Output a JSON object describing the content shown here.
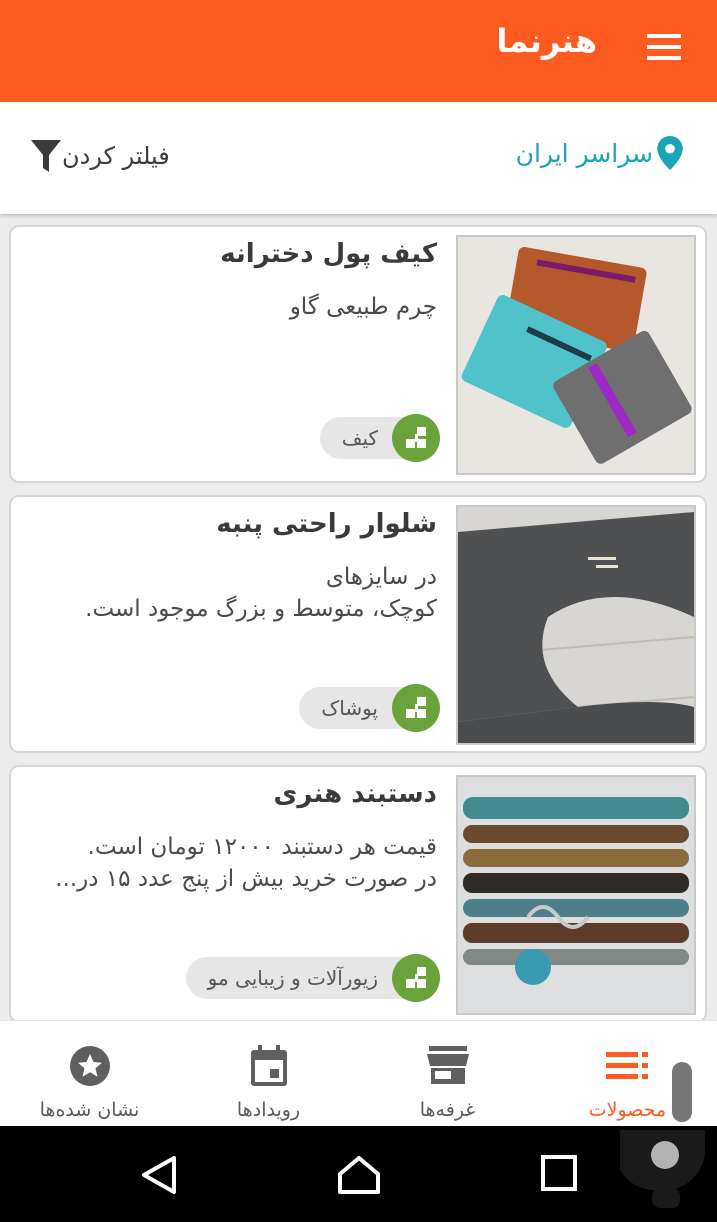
{
  "app": {
    "title": "هنرنما"
  },
  "filterbar": {
    "location": "سراسر ایران",
    "filter": "فیلتر کردن"
  },
  "cards": [
    {
      "title": "کیف پول دخترانه",
      "desc_lines": [
        "چرم طبیعی گاو"
      ],
      "category": "کیف"
    },
    {
      "title": "شلوار راحتی پنبه",
      "desc_lines": [
        "در سایزهای",
        "کوچک، متوسط و بزرگ موجود است."
      ],
      "category": "پوشاک"
    },
    {
      "title": "دستبند هنری",
      "desc_lines": [
        "قیمت هر دستبند ۱۲۰۰۰ تومان است.",
        "در صورت خرید بیش از پنج عدد ۱۵ در..."
      ],
      "category": "زیورآلات و زیبایی مو"
    }
  ],
  "bottomnav": {
    "products": "محصولات",
    "booths": "غرفه‌ها",
    "events": "رویدادها",
    "bookmarks": "نشان شده‌ها"
  },
  "colors": {
    "primary": "#fd5b1f",
    "location": "#1aa4b5",
    "chip_icon": "#6aa33a"
  },
  "icons": {
    "menu": "hamburger-icon",
    "location": "map-pin-icon",
    "filter": "funnel-icon",
    "category": "category-tree-icon",
    "products": "list-icon",
    "booths": "store-icon",
    "events": "calendar-icon",
    "bookmarks": "star-icon"
  }
}
